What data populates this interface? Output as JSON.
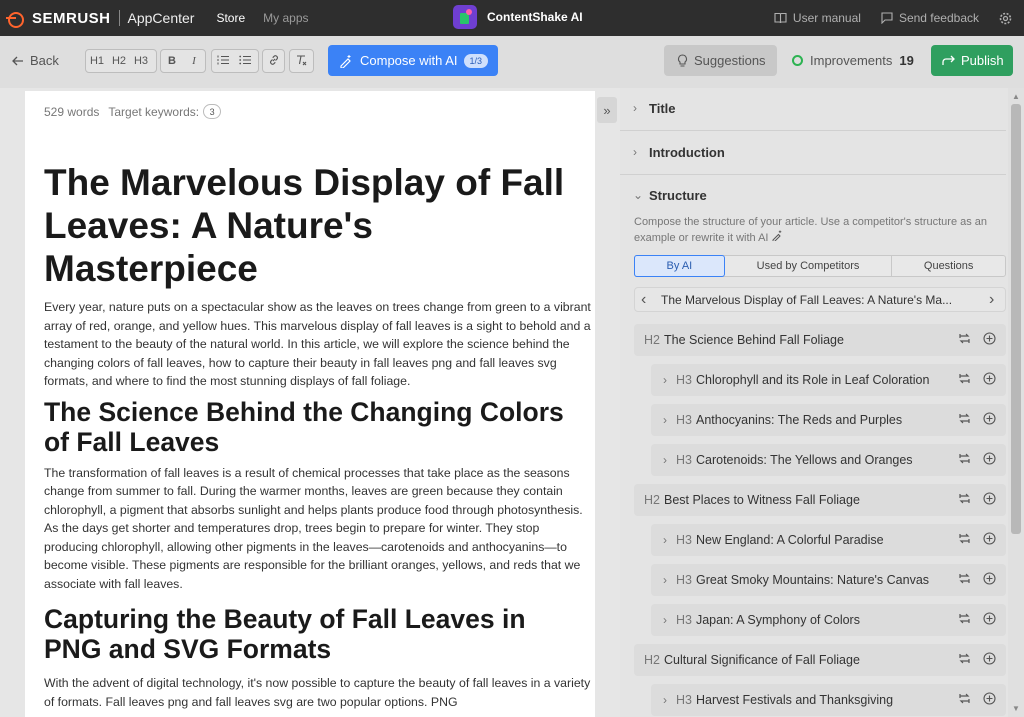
{
  "topnav": {
    "brand": "SEMRUSH",
    "app_center": "AppCenter",
    "store": "Store",
    "my_apps": "My apps",
    "app_title": "ContentShake AI",
    "user_manual": "User manual",
    "send_feedback": "Send feedback"
  },
  "toolbar": {
    "back": "Back",
    "format_buttons": [
      "H1",
      "H2",
      "H3",
      "B",
      "I"
    ],
    "compose": "Compose with AI",
    "compose_count": "1/3",
    "suggestions": "Suggestions",
    "improvements": "Improvements",
    "improvements_count": "19",
    "publish": "Publish"
  },
  "editor": {
    "word_count": "529 words",
    "target_keywords_label": "Target keywords:",
    "target_keywords_count": "3",
    "title": "The Marvelous Display of Fall Leaves: A Nature's Masterpiece",
    "intro": "Every year, nature puts on a spectacular show as the leaves on trees change from green to a vibrant array of red, orange, and yellow hues. This marvelous display of fall leaves is a sight to behold and a testament to the beauty of the natural world. In this article, we will explore the science behind the changing colors of fall leaves, how to capture their beauty in fall leaves png and fall leaves svg formats, and where to find the most stunning displays of fall foliage.",
    "h2_science": "The Science Behind the Changing Colors of Fall Leaves",
    "p_science": "The transformation of fall leaves is a result of chemical processes that take place as the seasons change from summer to fall. During the warmer months, leaves are green because they contain chlorophyll, a pigment that absorbs sunlight and helps plants produce food through photosynthesis. As the days get shorter and temperatures drop, trees begin to prepare for winter. They stop producing chlorophyll, allowing other pigments in the leaves—carotenoids and anthocyanins—to become visible. These pigments are responsible for the brilliant oranges, yellows, and reds that we associate with fall leaves.",
    "h2_capture": "Capturing the Beauty of Fall Leaves in PNG and SVG Formats",
    "p_capture": "With the advent of digital technology, it's now possible to capture the beauty of fall leaves in a variety of formats. Fall leaves png and fall leaves svg are two popular options. PNG"
  },
  "panel": {
    "title_section": "Title",
    "intro_section": "Introduction",
    "structure_section": "Structure",
    "structure_desc": "Compose the structure of your article. Use a competitor's structure as an example or rewrite it with AI",
    "tabs": [
      "By AI",
      "Used by Competitors",
      "Questions"
    ],
    "pager_text": "The Marvelous Display of Fall Leaves: A Nature's Ma...",
    "outline": [
      {
        "level": "H2",
        "text": "The Science Behind Fall Foliage"
      },
      {
        "level": "H3",
        "text": "Chlorophyll and its Role in Leaf Coloration"
      },
      {
        "level": "H3",
        "text": "Anthocyanins: The Reds and Purples"
      },
      {
        "level": "H3",
        "text": "Carotenoids: The Yellows and Oranges"
      },
      {
        "level": "H2",
        "text": "Best Places to Witness Fall Foliage"
      },
      {
        "level": "H3",
        "text": "New England: A Colorful Paradise"
      },
      {
        "level": "H3",
        "text": "Great Smoky Mountains: Nature's Canvas"
      },
      {
        "level": "H3",
        "text": "Japan: A Symphony of Colors"
      },
      {
        "level": "H2",
        "text": "Cultural Significance of Fall Foliage"
      },
      {
        "level": "H3",
        "text": "Harvest Festivals and Thanksgiving"
      }
    ]
  },
  "colors": {
    "brand": "#ff642d",
    "compose": "#3b82f6",
    "publish": "#2f9f5f",
    "improvement_ring": "#2db352"
  }
}
